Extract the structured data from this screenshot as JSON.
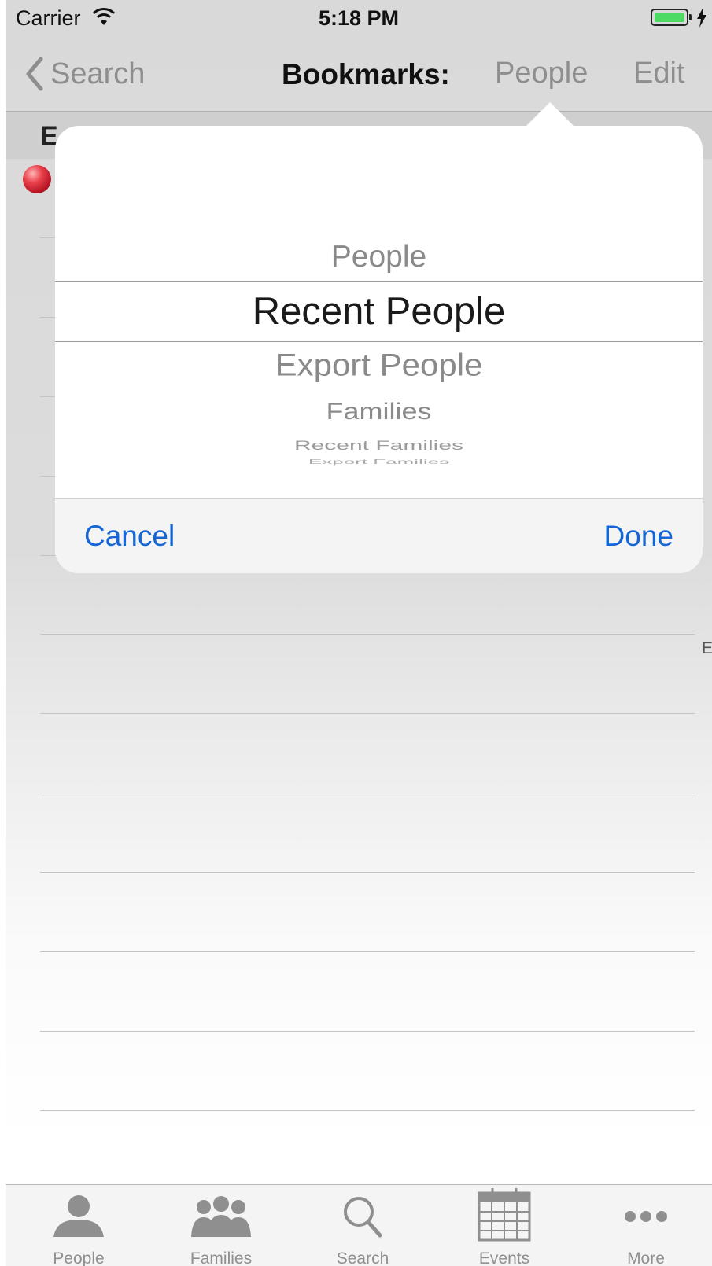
{
  "status_bar": {
    "carrier": "Carrier",
    "time": "5:18 PM"
  },
  "nav": {
    "back_label": "Search",
    "title": "Bookmarks:",
    "people_label": "People",
    "edit_label": "Edit"
  },
  "list": {
    "section_letter": "E",
    "index_letter": "E"
  },
  "picker": {
    "items": [
      "People",
      "Recent People",
      "Export People",
      "Families",
      "Recent Families",
      "Export Families"
    ],
    "selected": "Recent People"
  },
  "popover": {
    "cancel_label": "Cancel",
    "done_label": "Done"
  },
  "tab_bar": {
    "tabs": [
      {
        "label": "People",
        "icon": "person-icon"
      },
      {
        "label": "Families",
        "icon": "families-icon"
      },
      {
        "label": "Search",
        "icon": "search-icon"
      },
      {
        "label": "Events",
        "icon": "calendar-icon"
      },
      {
        "label": "More",
        "icon": "more-icon"
      }
    ]
  },
  "colors": {
    "accent": "#1465d6",
    "battery": "#4cd964",
    "inactive": "#8f8f8f"
  }
}
